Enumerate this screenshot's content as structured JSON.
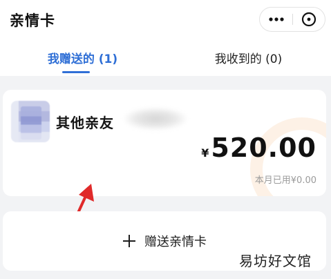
{
  "header": {
    "title": "亲情卡",
    "more_icon": "more-dots-icon",
    "close_icon": "close-circle-icon"
  },
  "tabs": [
    {
      "label": "我赠送的 (1)",
      "active": true
    },
    {
      "label": "我收到的 (0)",
      "active": false
    }
  ],
  "card": {
    "recipient_name": "其他亲友",
    "currency": "¥",
    "amount": "520.00",
    "used_text": "本月已用¥0.00"
  },
  "gift_button": {
    "label": "赠送亲情卡",
    "icon": "plus-icon"
  },
  "watermark": "易坊好文馆",
  "colors": {
    "accent": "#2f6fd6",
    "background": "#f2f3f5",
    "arrow": "#e02a2a"
  }
}
